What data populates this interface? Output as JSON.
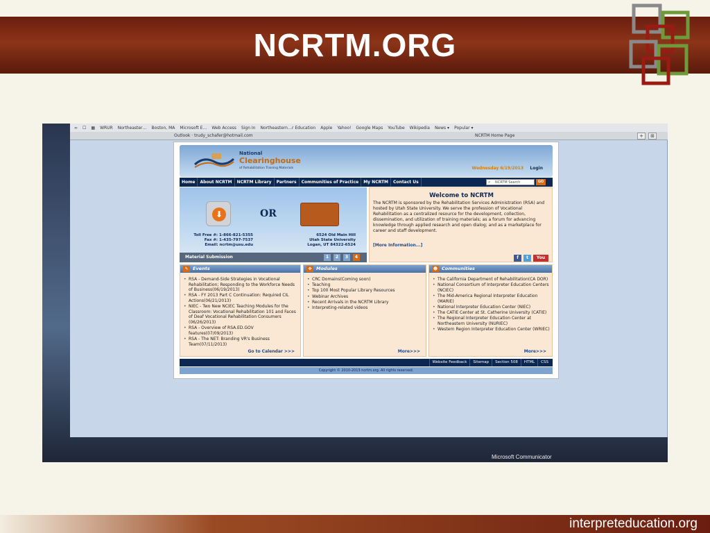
{
  "slide": {
    "title": "NCRTM.ORG",
    "footer": "interpreteducation.org"
  },
  "browser": {
    "bookmarks": [
      "∞",
      "☐",
      "▦",
      "WRUR",
      "Northeaster…",
      "Boston, MA",
      "Microsoft E…",
      "Web Access",
      "Sign In",
      "Northeastern…r Education",
      "Apple",
      "Yahoo!",
      "Google Maps",
      "YouTube",
      "Wikipedia",
      "News ▾",
      "Popular ▾"
    ],
    "tab_left": "Outlook · trudy_schafer@hotmail.com",
    "tab_right": "NCRTM Home Page",
    "new_tab_label": "+",
    "tabs_overview_label": "⊞"
  },
  "site": {
    "org_national": "National",
    "org_clearinghouse": "Clearinghouse",
    "org_sub": "of Rehabilitation Training Materials",
    "date": "Wednesday 6/19/2013",
    "login": "Login",
    "nav": [
      "Home",
      "About NCRTM",
      "NCRTM Library",
      "Partners",
      "Communities of Practice",
      "My NCRTM",
      "Contact Us"
    ],
    "search_placeholder": "NCRTM Search",
    "search_go": "GO",
    "promo": {
      "or_label": "OR",
      "left_contact": [
        "Toll Free #: 1-866-821-5355",
        "Fax #: 1-435-797-7537",
        "Email: ncrtm@usu.edu"
      ],
      "right_contact": [
        "6524 Old Main Hill",
        "Utah State University",
        "Logan, UT 84322-6524"
      ],
      "bar_label": "Material Submission",
      "pages": [
        "1",
        "2",
        "3",
        "4"
      ],
      "active_page": "4"
    },
    "welcome": {
      "title": "Welcome to NCRTM",
      "body": "The NCRTM is sponsored by the Rehabilitation Services Administration (RSA) and hosted by Utah State University. We serve the profession of Vocational Rehabilitation as a centralized resource for the development, collection, dissemination, and utilization of training materials; as a forum for advancing knowledge through applied research and open dialog; and as a marketplace for career and staff development.",
      "more": "[More Information...]",
      "social": [
        "f",
        "t",
        "You"
      ]
    },
    "events": {
      "title": "Events",
      "items": [
        "RSA - Demand-Side Strategies in Vocational Rehabilitation; Responding to the Workforce Needs of Business(06/19/2013)",
        "RSA - FY 2013 Part C Continuation: Required CIL Actions(06/21/2013)",
        "NIEC - Two New NCIEC Teaching Modules for the Classroom: Vocational Rehabilitation 101 and Faces of Deaf Vocational Rehabilitation Consumers (06/26/2013)",
        "RSA - Overview of RSA.ED.GOV features(07/09/2013)",
        "RSA - The NET: Branding VR's Business Team(07/11/2013)"
      ],
      "more": "Go to Calendar >>>"
    },
    "modules": {
      "title": "Modules",
      "items": [
        "CRC Domains(Coming soon)",
        "Teaching",
        "Top 100 Most Popular Library Resources",
        "Webinar Archives",
        "Recent Arrivals in the NCRTM Library",
        "Interpreting-related videos"
      ],
      "more": "More>>>"
    },
    "communities": {
      "title": "Communities",
      "items": [
        "The California Department of Rehabilitation(CA DOR)",
        "National Consortium of Interpreter Education Centers (NCIEC)",
        "The Mid-America Regional Interpreter Education (MARIE)",
        "National Interpreter Education Center (NIEC)",
        "The CATIE Center at St. Catherine University (CATIE)",
        "The Regional Interpreter Education Center at Northeastern University (NURIEC)",
        "Western Region Interpreter Education Center (WRIEC)"
      ],
      "more": "More>>>"
    },
    "utility_links": [
      "Website Feedback",
      "Sitemap",
      "Section 508",
      "HTML",
      "CSS"
    ],
    "copyright": "Copyright © 2010-2013 ncrtm.org. All rights reserved."
  },
  "taskbar": {
    "communicator": "Microsoft Communicator"
  },
  "colors": {
    "banner": "#7a2812",
    "nav": "#0c2852",
    "accent": "#d86b14",
    "panel": "#fbe8d4"
  }
}
